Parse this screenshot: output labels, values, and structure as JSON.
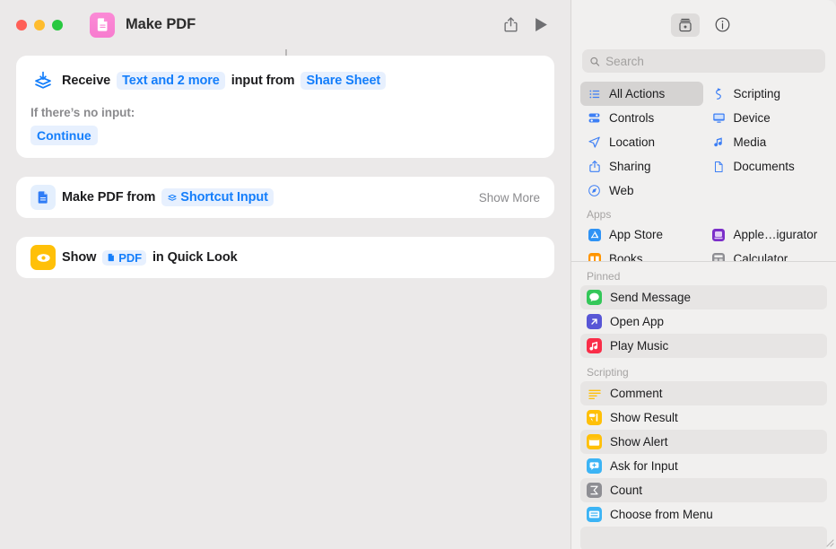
{
  "window": {
    "traffic_lights": [
      "close",
      "minimize",
      "zoom"
    ],
    "app_icon": "pdf-document-icon",
    "title": "Make PDF",
    "share_button": "share-icon",
    "run_button": "play-icon"
  },
  "editor": {
    "actions": [
      {
        "icon": "receive-input-icon",
        "prefix": "Receive",
        "token1": "Text and 2 more",
        "middle": "input from",
        "token2": "Share Sheet",
        "sub_label": "If there’s no input:",
        "sub_value": "Continue"
      },
      {
        "icon": "make-pdf-icon",
        "prefix": "Make PDF from",
        "token1": "Shortcut Input",
        "trailing": "Show More"
      },
      {
        "icon": "quick-look-icon",
        "prefix": "Show",
        "token1": "PDF",
        "suffix": "in Quick Look"
      }
    ]
  },
  "library": {
    "toolbar": {
      "action_library_button": "action-library-icon",
      "info_button": "info-circle-icon"
    },
    "search": {
      "icon": "search-icon",
      "placeholder": "Search",
      "value": ""
    },
    "categories": [
      {
        "label": "All Actions",
        "icon": "list-bullet-icon",
        "selected": true
      },
      {
        "label": "Scripting",
        "icon": "scripting-icon",
        "selected": false
      },
      {
        "label": "Controls",
        "icon": "controls-icon",
        "selected": false
      },
      {
        "label": "Device",
        "icon": "device-display-icon",
        "selected": false
      },
      {
        "label": "Location",
        "icon": "location-arrow-icon",
        "selected": false
      },
      {
        "label": "Media",
        "icon": "music-note-icon",
        "selected": false
      },
      {
        "label": "Sharing",
        "icon": "share-up-icon",
        "selected": false
      },
      {
        "label": "Documents",
        "icon": "document-page-icon",
        "selected": false
      },
      {
        "label": "Web",
        "icon": "safari-compass-icon",
        "selected": false
      }
    ],
    "apps_group_label": "Apps",
    "apps": [
      {
        "label": "App Store",
        "icon": "app-store-icon",
        "color": "#2f93f5"
      },
      {
        "label": "Apple…igurator",
        "icon": "apple-configurator-icon",
        "color": "#7b2ec9"
      },
      {
        "label": "Books",
        "icon": "books-icon",
        "color": "#ff9500"
      },
      {
        "label": "Calculator",
        "icon": "calculator-icon",
        "color": "#8e8e93"
      }
    ],
    "sections": [
      {
        "title": "Pinned",
        "items": [
          {
            "label": "Send Message",
            "icon": "messages-icon",
            "color": "#34c759",
            "alt": true
          },
          {
            "label": "Open App",
            "icon": "open-app-icon",
            "color": "#5856d6",
            "alt": false
          },
          {
            "label": "Play Music",
            "icon": "play-music-icon",
            "color": "#fa2d48",
            "alt": true
          }
        ]
      },
      {
        "title": "Scripting",
        "items": [
          {
            "label": "Comment",
            "icon": "comment-icon",
            "color": "#ffc008",
            "alt": true
          },
          {
            "label": "Show Result",
            "icon": "show-result-icon",
            "color": "#ffc008",
            "alt": false
          },
          {
            "label": "Show Alert",
            "icon": "show-alert-icon",
            "color": "#ffc008",
            "alt": true
          },
          {
            "label": "Ask for Input",
            "icon": "ask-for-input-icon",
            "color": "#3cb4f5",
            "alt": false
          },
          {
            "label": "Count",
            "icon": "count-sigma-icon",
            "color": "#8e8e93",
            "alt": true
          },
          {
            "label": "Choose from Menu",
            "icon": "choose-from-menu-icon",
            "color": "#3cb4f5",
            "alt": false
          }
        ]
      }
    ]
  },
  "colors": {
    "accent_blue": "#147efb",
    "token_bg": "#e7f0fe",
    "window_bg": "#ebe9e9",
    "library_bg": "#f1f0ef",
    "card_bg": "#ffffff"
  }
}
